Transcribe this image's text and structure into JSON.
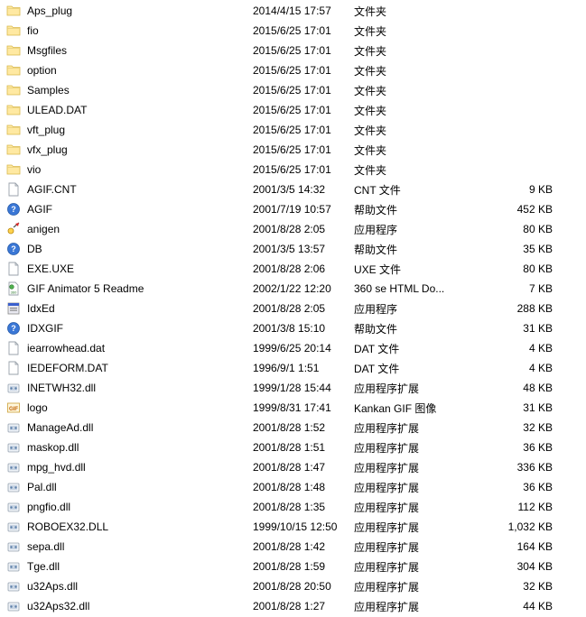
{
  "files": [
    {
      "icon": "folder",
      "name": "Aps_plug",
      "date": "2014/4/15 17:57",
      "type": "文件夹",
      "size": ""
    },
    {
      "icon": "folder",
      "name": "fio",
      "date": "2015/6/25 17:01",
      "type": "文件夹",
      "size": ""
    },
    {
      "icon": "folder",
      "name": "Msgfiles",
      "date": "2015/6/25 17:01",
      "type": "文件夹",
      "size": ""
    },
    {
      "icon": "folder",
      "name": "option",
      "date": "2015/6/25 17:01",
      "type": "文件夹",
      "size": ""
    },
    {
      "icon": "folder",
      "name": "Samples",
      "date": "2015/6/25 17:01",
      "type": "文件夹",
      "size": ""
    },
    {
      "icon": "folder",
      "name": "ULEAD.DAT",
      "date": "2015/6/25 17:01",
      "type": "文件夹",
      "size": ""
    },
    {
      "icon": "folder",
      "name": "vft_plug",
      "date": "2015/6/25 17:01",
      "type": "文件夹",
      "size": ""
    },
    {
      "icon": "folder",
      "name": "vfx_plug",
      "date": "2015/6/25 17:01",
      "type": "文件夹",
      "size": ""
    },
    {
      "icon": "folder",
      "name": "vio",
      "date": "2015/6/25 17:01",
      "type": "文件夹",
      "size": ""
    },
    {
      "icon": "file",
      "name": "AGIF.CNT",
      "date": "2001/3/5 14:32",
      "type": "CNT 文件",
      "size": "9 KB"
    },
    {
      "icon": "help",
      "name": "AGIF",
      "date": "2001/7/19 10:57",
      "type": "帮助文件",
      "size": "452 KB"
    },
    {
      "icon": "app-ani",
      "name": "anigen",
      "date": "2001/8/28 2:05",
      "type": "应用程序",
      "size": "80 KB"
    },
    {
      "icon": "help",
      "name": "DB",
      "date": "2001/3/5 13:57",
      "type": "帮助文件",
      "size": "35 KB"
    },
    {
      "icon": "file",
      "name": "EXE.UXE",
      "date": "2001/8/28 2:06",
      "type": "UXE 文件",
      "size": "80 KB"
    },
    {
      "icon": "html",
      "name": "GIF Animator 5 Readme",
      "date": "2002/1/22 12:20",
      "type": "360 se HTML Do...",
      "size": "7 KB"
    },
    {
      "icon": "app-idx",
      "name": "IdxEd",
      "date": "2001/8/28 2:05",
      "type": "应用程序",
      "size": "288 KB"
    },
    {
      "icon": "help",
      "name": "IDXGIF",
      "date": "2001/3/8 15:10",
      "type": "帮助文件",
      "size": "31 KB"
    },
    {
      "icon": "file",
      "name": "iearrowhead.dat",
      "date": "1999/6/25 20:14",
      "type": "DAT 文件",
      "size": "4 KB"
    },
    {
      "icon": "file",
      "name": "IEDEFORM.DAT",
      "date": "1996/9/1 1:51",
      "type": "DAT 文件",
      "size": "4 KB"
    },
    {
      "icon": "dll",
      "name": "INETWH32.dll",
      "date": "1999/1/28 15:44",
      "type": "应用程序扩展",
      "size": "48 KB"
    },
    {
      "icon": "gif",
      "name": "logo",
      "date": "1999/8/31 17:41",
      "type": "Kankan GIF 图像",
      "size": "31 KB"
    },
    {
      "icon": "dll",
      "name": "ManageAd.dll",
      "date": "2001/8/28 1:52",
      "type": "应用程序扩展",
      "size": "32 KB"
    },
    {
      "icon": "dll",
      "name": "maskop.dll",
      "date": "2001/8/28 1:51",
      "type": "应用程序扩展",
      "size": "36 KB"
    },
    {
      "icon": "dll",
      "name": "mpg_hvd.dll",
      "date": "2001/8/28 1:47",
      "type": "应用程序扩展",
      "size": "336 KB"
    },
    {
      "icon": "dll",
      "name": "Pal.dll",
      "date": "2001/8/28 1:48",
      "type": "应用程序扩展",
      "size": "36 KB"
    },
    {
      "icon": "dll",
      "name": "pngfio.dll",
      "date": "2001/8/28 1:35",
      "type": "应用程序扩展",
      "size": "112 KB"
    },
    {
      "icon": "dll",
      "name": "ROBOEX32.DLL",
      "date": "1999/10/15 12:50",
      "type": "应用程序扩展",
      "size": "1,032 KB"
    },
    {
      "icon": "dll",
      "name": "sepa.dll",
      "date": "2001/8/28 1:42",
      "type": "应用程序扩展",
      "size": "164 KB"
    },
    {
      "icon": "dll",
      "name": "Tge.dll",
      "date": "2001/8/28 1:59",
      "type": "应用程序扩展",
      "size": "304 KB"
    },
    {
      "icon": "dll",
      "name": "u32Aps.dll",
      "date": "2001/8/28 20:50",
      "type": "应用程序扩展",
      "size": "32 KB"
    },
    {
      "icon": "dll",
      "name": "u32Aps32.dll",
      "date": "2001/8/28 1:27",
      "type": "应用程序扩展",
      "size": "44 KB"
    }
  ]
}
